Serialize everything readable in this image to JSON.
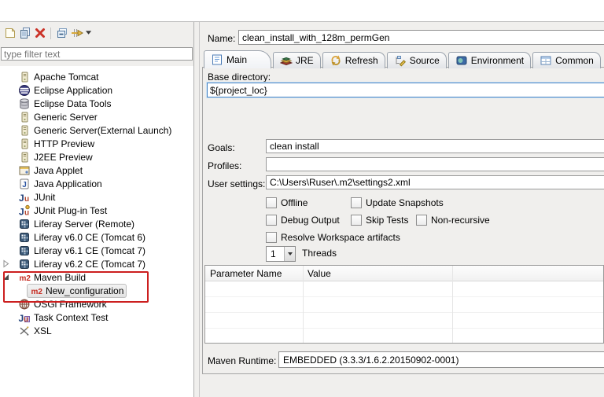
{
  "sidebar": {
    "toolbar": [
      {
        "name": "new-configuration",
        "icon": "new-config"
      },
      {
        "name": "duplicate-configuration",
        "icon": "duplicate"
      },
      {
        "name": "delete-configuration",
        "icon": "delete"
      },
      {
        "name": "collapse-all",
        "icon": "collapse-all"
      },
      {
        "name": "filter-launch-configurations",
        "icon": "filter"
      }
    ],
    "filter_placeholder": "type filter text",
    "tree": [
      {
        "label": "Apache Tomcat",
        "icon": "server",
        "level": 1
      },
      {
        "label": "Eclipse Application",
        "icon": "eclipse",
        "level": 1
      },
      {
        "label": "Eclipse Data Tools",
        "icon": "database",
        "level": 1
      },
      {
        "label": "Generic Server",
        "icon": "server",
        "level": 1
      },
      {
        "label": "Generic Server(External Launch)",
        "icon": "server",
        "level": 1
      },
      {
        "label": "HTTP Preview",
        "icon": "server",
        "level": 1
      },
      {
        "label": "J2EE Preview",
        "icon": "server",
        "level": 1
      },
      {
        "label": "Java Applet",
        "icon": "applet",
        "level": 1
      },
      {
        "label": "Java Application",
        "icon": "java",
        "level": 1
      },
      {
        "label": "JUnit",
        "icon": "junit",
        "level": 1
      },
      {
        "label": "JUnit Plug-in Test",
        "icon": "junit-plugin",
        "level": 1
      },
      {
        "label": "Liferay Server (Remote)",
        "icon": "liferay",
        "level": 1
      },
      {
        "label": "Liferay v6.0 CE (Tomcat 6)",
        "icon": "liferay",
        "level": 1
      },
      {
        "label": "Liferay v6.1 CE (Tomcat 7)",
        "icon": "liferay",
        "level": 1
      },
      {
        "label": "Liferay v6.2 CE (Tomcat 7)",
        "icon": "liferay",
        "level": 1,
        "expander": "collapsed"
      },
      {
        "label": "Maven Build",
        "icon": "m2",
        "level": 1,
        "expander": "expanded"
      },
      {
        "label": "New_configuration",
        "icon": "m2",
        "level": 2,
        "selected": true
      },
      {
        "label": "OSGi Framework",
        "icon": "osgi",
        "level": 1
      },
      {
        "label": "Task Context Test",
        "icon": "task-context",
        "level": 1
      },
      {
        "label": "XSL",
        "icon": "xsl",
        "level": 1
      }
    ],
    "annotation_color": "#cc1f1f"
  },
  "form": {
    "name_label": "Name:",
    "name_value": "clean_install_with_128m_permGen",
    "tabs": [
      {
        "label": "Main",
        "icon": "tab-main",
        "selected": true
      },
      {
        "label": "JRE",
        "icon": "tab-jre",
        "selected": false
      },
      {
        "label": "Refresh",
        "icon": "tab-refresh",
        "selected": false
      },
      {
        "label": "Source",
        "icon": "tab-source",
        "selected": false
      },
      {
        "label": "Environment",
        "icon": "tab-environment",
        "selected": false
      },
      {
        "label": "Common",
        "icon": "tab-common",
        "selected": false
      }
    ],
    "base_directory": {
      "label": "Base directory:",
      "value": "${project_loc}"
    },
    "goals": {
      "label": "Goals:",
      "value": "clean install"
    },
    "profiles": {
      "label": "Profiles:",
      "value": ""
    },
    "user_settings": {
      "label": "User settings:",
      "value": "C:\\Users\\Ruser\\.m2\\settings2.xml"
    },
    "checkboxes": [
      {
        "label": "Offline",
        "checked": false
      },
      {
        "label": "Update Snapshots",
        "checked": false
      },
      {
        "label": "Debug Output",
        "checked": false
      },
      {
        "label": "Skip Tests",
        "checked": false
      },
      {
        "label": "Non-recursive",
        "checked": false
      },
      {
        "label": "Resolve Workspace artifacts",
        "checked": false
      }
    ],
    "threads": {
      "value": "1",
      "label": "Threads"
    },
    "parameters_table": {
      "columns": [
        "Parameter Name",
        "Value"
      ],
      "rows": [],
      "empty_row_count": 4
    },
    "maven_runtime": {
      "label": "Maven Runtime:",
      "value": "EMBEDDED (3.3.3/1.6.2.20150902-0001)"
    }
  }
}
